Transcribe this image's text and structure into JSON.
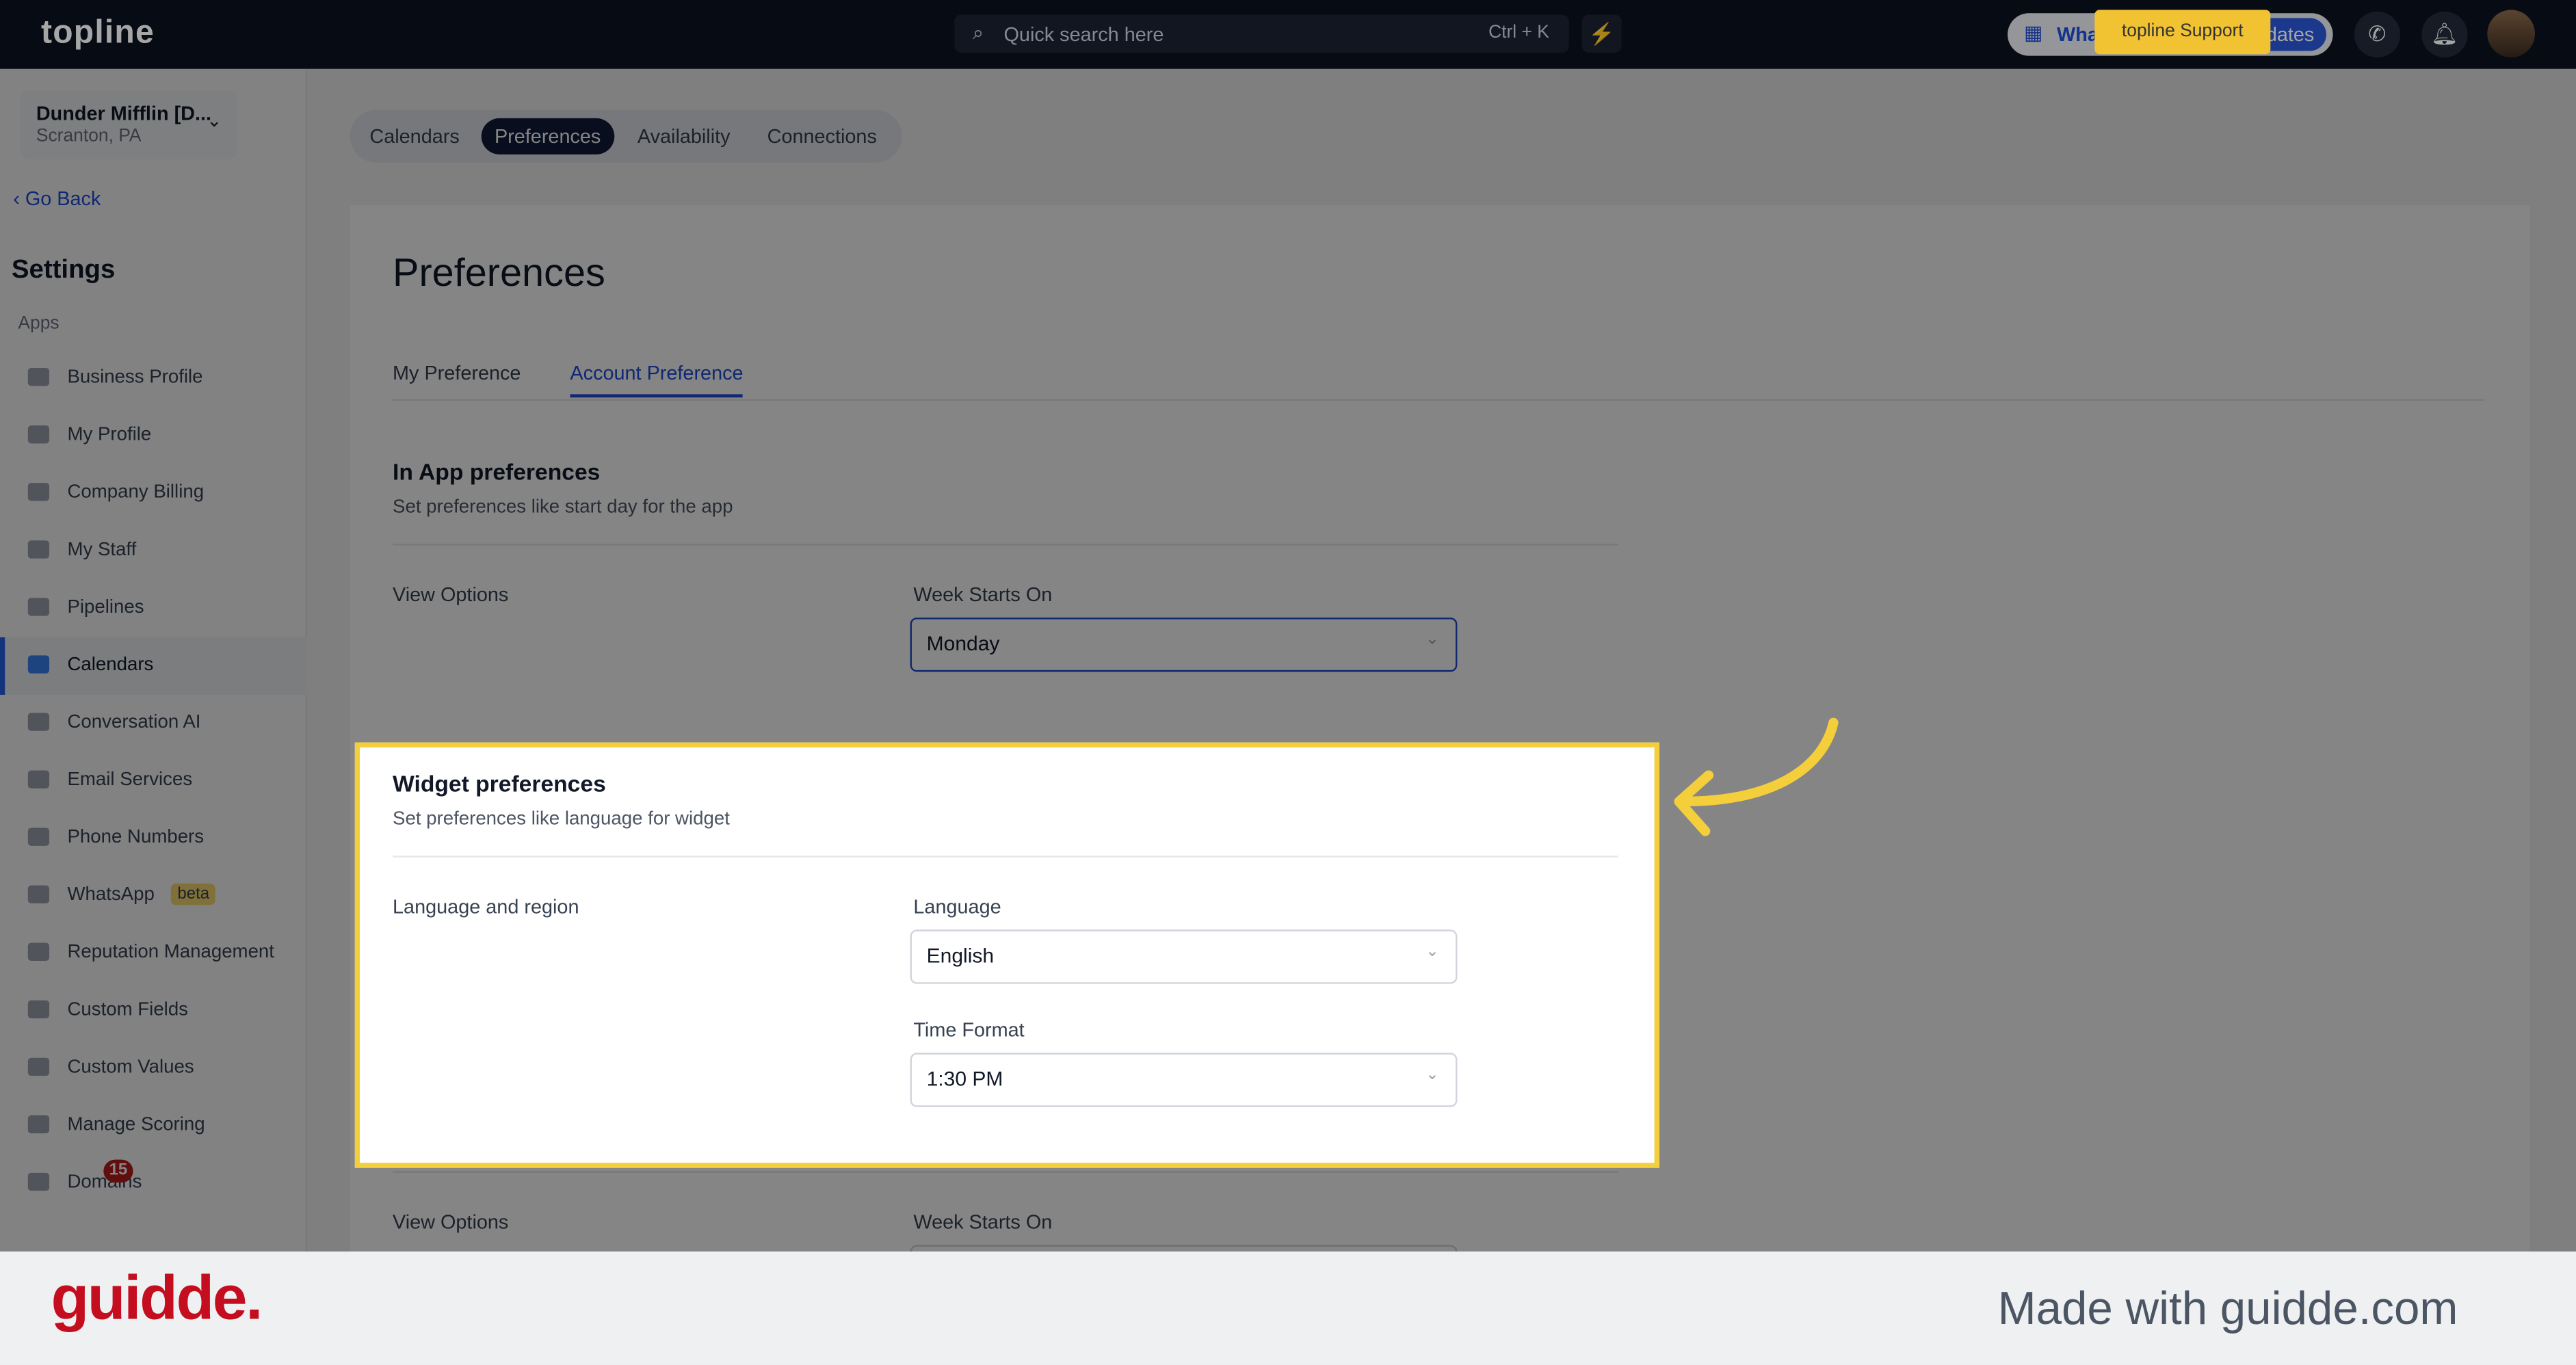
{
  "topbar": {
    "logo": "topline",
    "search_placeholder": "Quick search here",
    "search_shortcut": "Ctrl + K",
    "whats_new": "What's New",
    "updates": "dates",
    "support": "topline Support"
  },
  "sidebar": {
    "company_name": "Dunder Mifflin [D...",
    "company_location": "Scranton, PA",
    "go_back": "Go Back",
    "title": "Settings",
    "section": "Apps",
    "items": [
      {
        "label": "Business Profile"
      },
      {
        "label": "My Profile"
      },
      {
        "label": "Company Billing"
      },
      {
        "label": "My Staff"
      },
      {
        "label": "Pipelines"
      },
      {
        "label": "Calendars",
        "active": true
      },
      {
        "label": "Conversation AI"
      },
      {
        "label": "Email Services"
      },
      {
        "label": "Phone Numbers"
      },
      {
        "label": "WhatsApp",
        "badge": "beta"
      },
      {
        "label": "Reputation Management"
      },
      {
        "label": "Custom Fields"
      },
      {
        "label": "Custom Values"
      },
      {
        "label": "Manage Scoring"
      },
      {
        "label": "Domains"
      }
    ],
    "notification_count": "15"
  },
  "main": {
    "tabs": [
      {
        "label": "Calendars"
      },
      {
        "label": "Preferences"
      },
      {
        "label": "Availability"
      },
      {
        "label": "Connections"
      }
    ],
    "title": "Preferences",
    "subtabs": [
      {
        "label": "My Preference"
      },
      {
        "label": "Account Preference"
      }
    ],
    "in_app": {
      "title": "In App preferences",
      "subtitle": "Set preferences like start day for the app",
      "row_label": "View Options",
      "field_label": "Week Starts On",
      "value": "Monday"
    },
    "widget": {
      "title": "Widget preferences",
      "subtitle": "Set preferences like language for widget",
      "row_label": "Language and region",
      "language_label": "Language",
      "language_value": "English",
      "time_label": "Time Format",
      "time_value": "1:30 PM"
    },
    "below": {
      "row_label": "View Options",
      "field_label": "Week Starts On"
    }
  },
  "footer": {
    "logo": "guidde.",
    "made_with": "Made with guidde.com"
  },
  "colors": {
    "accent": "#1d4ed8",
    "highlight": "#f5cf3b",
    "brand": "#c40d1e"
  }
}
